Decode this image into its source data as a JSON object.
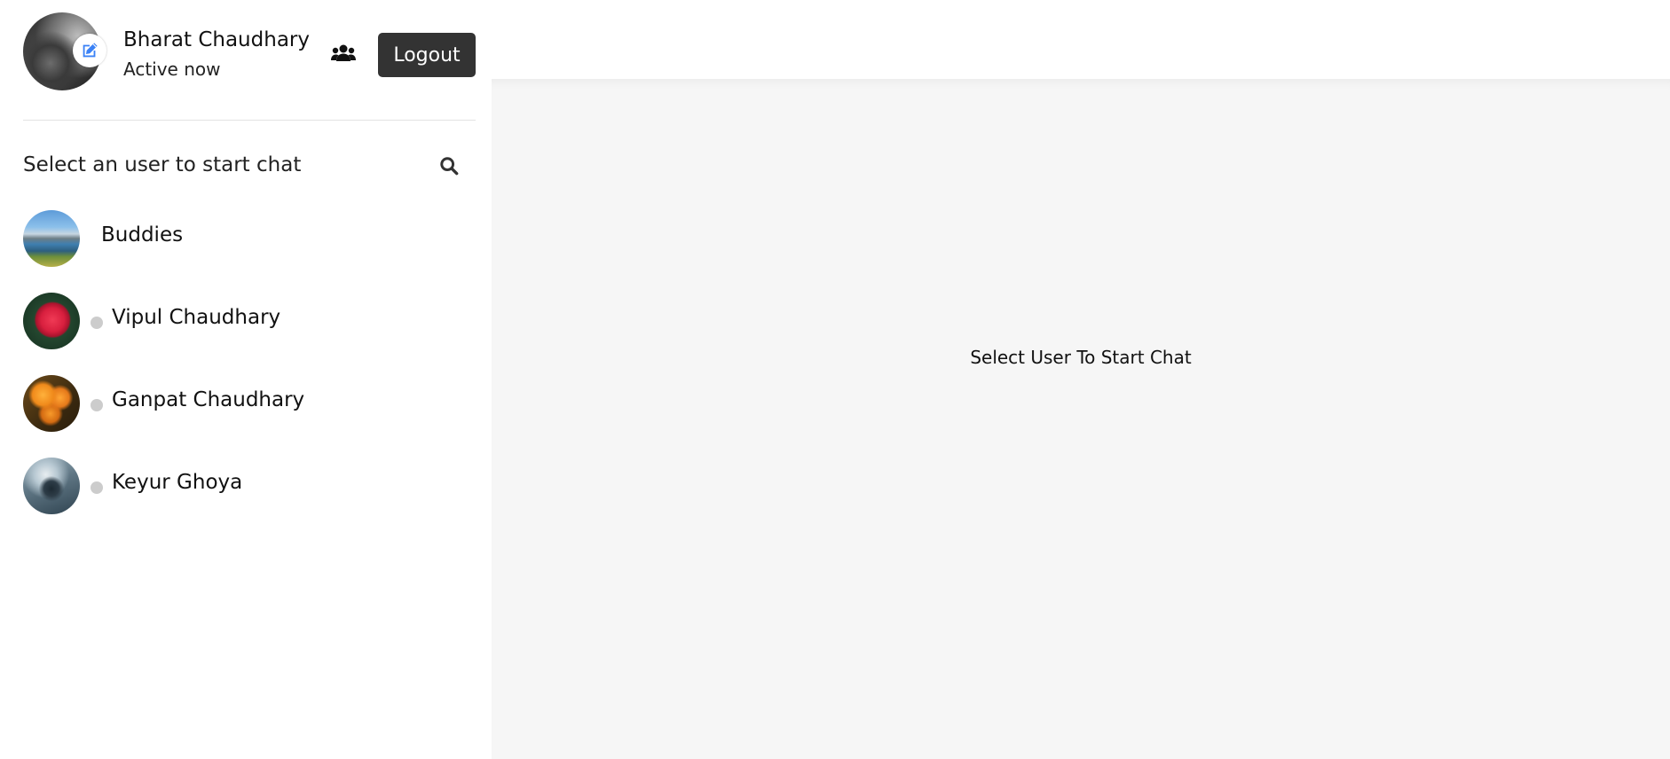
{
  "profile": {
    "name": "Bharat Chaudhary",
    "status": "Active now",
    "avatar_icon": "profile-photo",
    "edit_icon": "edit-icon"
  },
  "header": {
    "group_icon": "users-group-icon",
    "logout_label": "Logout"
  },
  "search": {
    "label": "Select an user to start chat",
    "icon": "search-icon"
  },
  "contacts": [
    {
      "name": "Buddies",
      "type": "group",
      "online": null
    },
    {
      "name": "Vipul Chaudhary",
      "type": "user",
      "online": false
    },
    {
      "name": "Ganpat Chaudhary",
      "type": "user",
      "online": false
    },
    {
      "name": "Keyur Ghoya",
      "type": "user",
      "online": false
    }
  ],
  "main": {
    "empty_message": "Select User To Start Chat"
  },
  "colors": {
    "logout_bg": "#333333",
    "edit_icon": "#3b82f6",
    "status_dot_offline": "#cccccc",
    "main_bg": "#f6f6f6"
  }
}
